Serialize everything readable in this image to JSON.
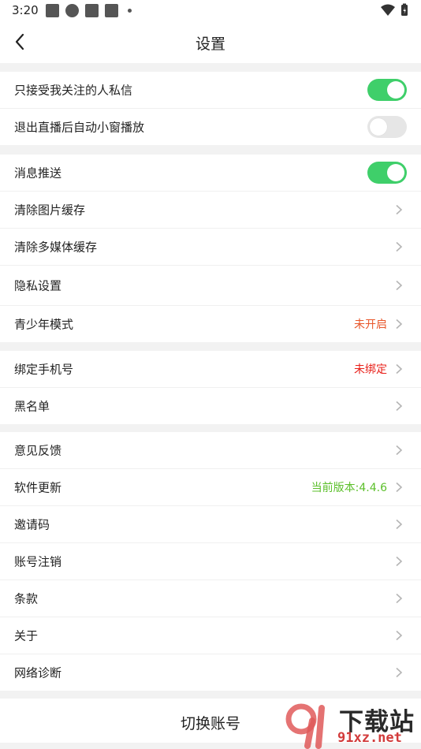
{
  "status_bar": {
    "time": "3:20"
  },
  "nav": {
    "title": "设置"
  },
  "groups": [
    {
      "items": [
        {
          "label": "只接受我关注的人私信",
          "control": "toggle",
          "on": true
        },
        {
          "label": "退出直播后自动小窗播放",
          "control": "toggle",
          "on": false
        }
      ]
    },
    {
      "items": [
        {
          "label": "消息推送",
          "control": "toggle",
          "on": true
        },
        {
          "label": "清除图片缓存",
          "control": "chevron"
        },
        {
          "label": "清除多媒体缓存",
          "control": "chevron"
        },
        {
          "label": "隐私设置",
          "control": "chevron"
        },
        {
          "label": "青少年模式",
          "control": "chevron",
          "value": "未开启",
          "value_color": "#e8562a"
        }
      ]
    },
    {
      "items": [
        {
          "label": "绑定手机号",
          "control": "chevron",
          "value": "未绑定",
          "value_color": "#e8201a"
        },
        {
          "label": "黑名单",
          "control": "chevron"
        }
      ]
    },
    {
      "items": [
        {
          "label": "意见反馈",
          "control": "chevron"
        },
        {
          "label": "软件更新",
          "control": "chevron",
          "value": "当前版本:4.4.6",
          "value_color": "#5bbf2a"
        },
        {
          "label": "邀请码",
          "control": "chevron"
        },
        {
          "label": "账号注销",
          "control": "chevron"
        },
        {
          "label": "条款",
          "control": "chevron"
        },
        {
          "label": "关于",
          "control": "chevron"
        },
        {
          "label": "网络诊断",
          "control": "chevron"
        }
      ]
    }
  ],
  "switch_account": {
    "label": "切换账号"
  },
  "watermark": {
    "line1": "下载站",
    "line2": "91xz.net"
  },
  "colors": {
    "toggle_on": "#3fcf6a",
    "toggle_off": "#e6e6e6",
    "chevron": "#b5b5b5"
  }
}
